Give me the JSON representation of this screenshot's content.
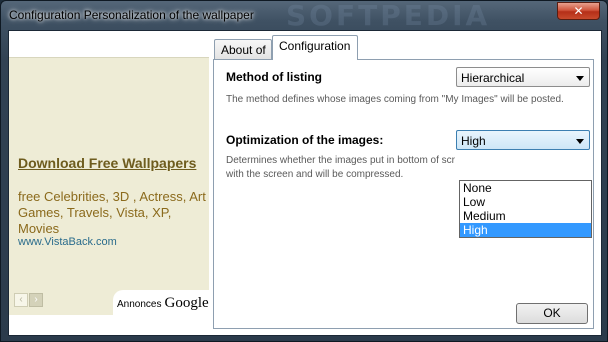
{
  "window": {
    "title": "Configuration Personalization of the wallpaper",
    "watermark": "SOFTPEDIA",
    "close_glyph": "✕"
  },
  "ad": {
    "title": "Download Free Wallpapers",
    "description": "free Celebrities, 3D , Actress, Art Games, Travels, Vista, XP, Movies",
    "url": "www.VistaBack.com",
    "nav_prev": "‹",
    "nav_next": "›",
    "annonces": "Annonces",
    "google": "Google"
  },
  "tabs": [
    {
      "label": "About of",
      "active": false
    },
    {
      "label": "Configuration",
      "active": true
    }
  ],
  "settings": {
    "listing": {
      "label": "Method of listing",
      "value": "Hierarchical",
      "description": "The method defines whose images coming from \"My Images\" will be posted."
    },
    "optimization": {
      "label": "Optimization of the images:",
      "value": "High",
      "description_line1": "Determines whether the images put in bottom of scr",
      "description_line2": "with the screen and will be compressed.",
      "options": [
        "None",
        "Low",
        "Medium",
        "High"
      ],
      "selected_option": "High"
    }
  },
  "buttons": {
    "ok": "OK"
  },
  "colors": {
    "selection": "#3399ff",
    "ad_background": "#eeecd6"
  }
}
